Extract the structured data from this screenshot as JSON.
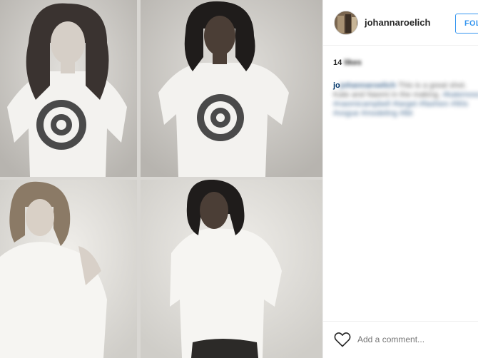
{
  "post": {
    "username": "johannaroelich",
    "follow_label": "FOLLOW",
    "likes_count": "14",
    "likes_suffix": "likes",
    "caption_user": "johannaroelich",
    "caption_text": "This is a great shot. Kate and Naomi in the making.",
    "caption_tags": "#katemoss #naomicampbell #target #fashion #90s #vogue #modeling #tbt",
    "comment_placeholder": "Add a comment..."
  },
  "icons": {
    "like": "heart-outline-icon",
    "avatar": "user-avatar"
  },
  "colors": {
    "follow_blue": "#3897f0",
    "link_blue": "#003569",
    "target_red": "#5a5a5a"
  }
}
